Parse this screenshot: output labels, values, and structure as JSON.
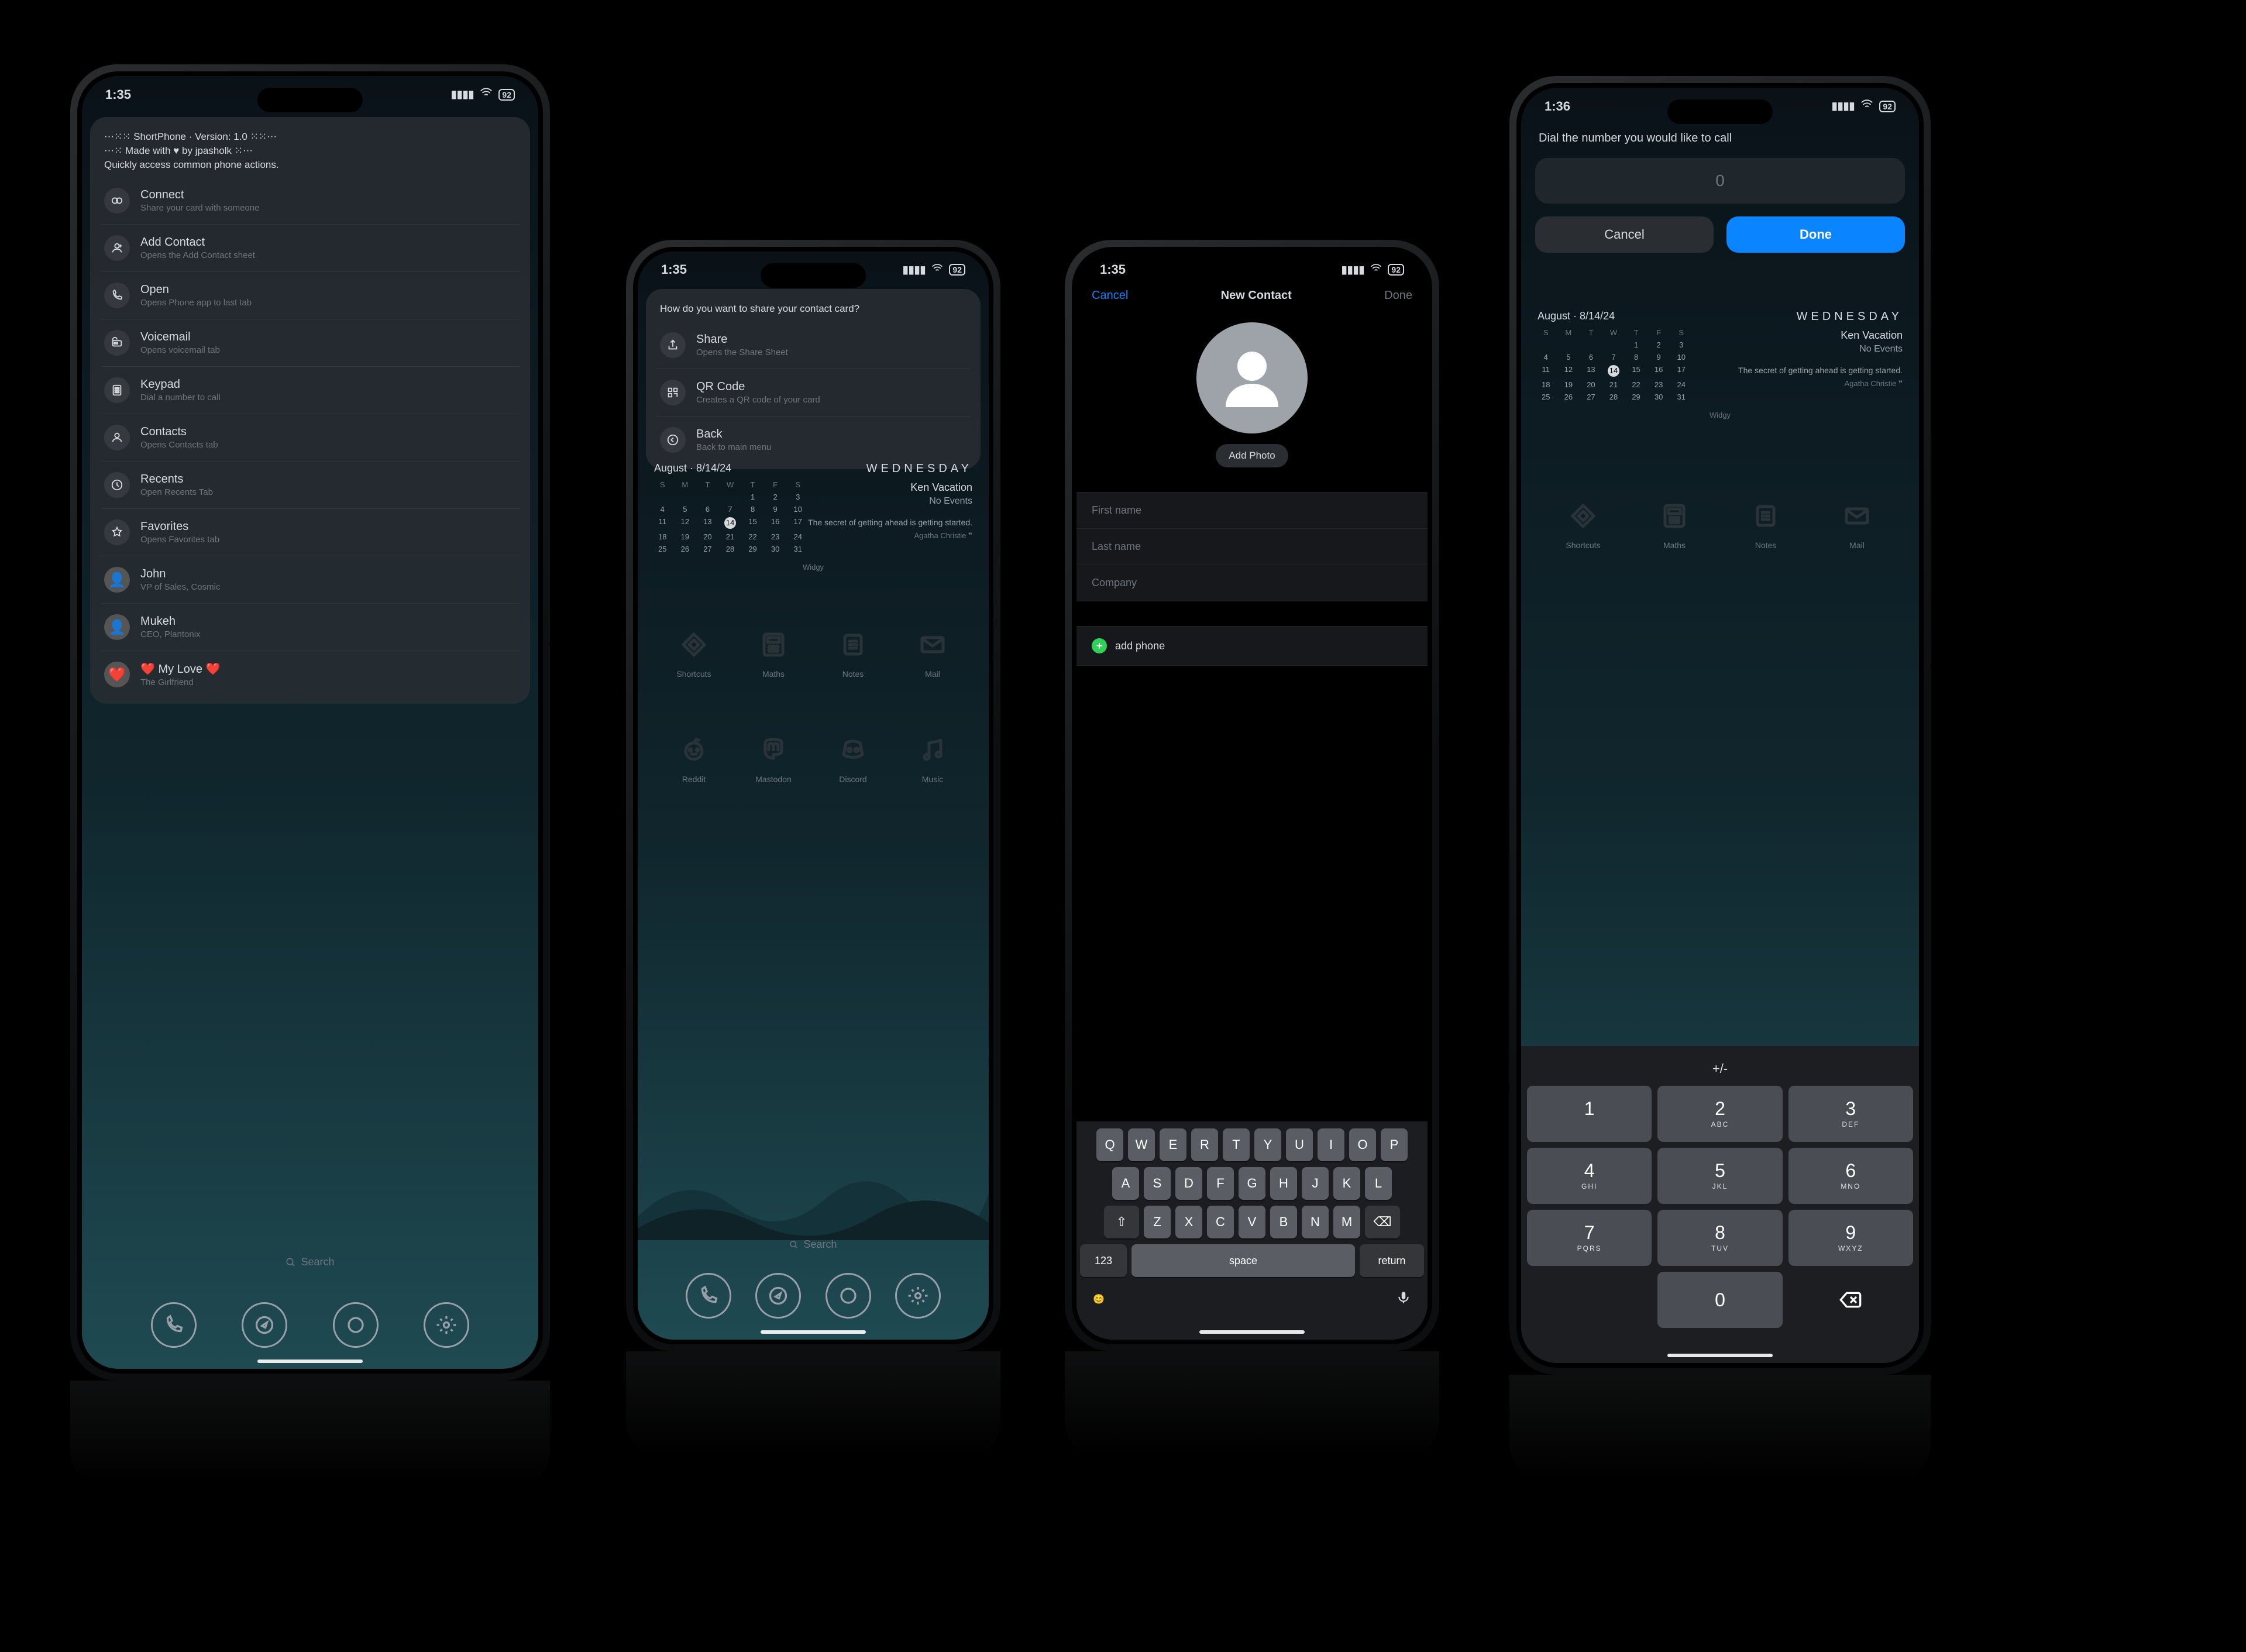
{
  "status": {
    "time1": "1:35",
    "time2": "1:35",
    "time3": "1:35",
    "time4": "1:36",
    "battery": "92"
  },
  "phone1": {
    "header_line1": "⋯⁙⁙ ShortPhone · Version: 1.0 ⁙⁙⋯",
    "header_line2": "⋯⁙ Made with ♥ by jpasholk ⁙⋯",
    "header_line3": "Quickly access common phone actions.",
    "rows": [
      {
        "title": "Connect",
        "sub": "Share your card with someone"
      },
      {
        "title": "Add Contact",
        "sub": "Opens the Add Contact sheet"
      },
      {
        "title": "Open",
        "sub": "Opens Phone app to last tab"
      },
      {
        "title": "Voicemail",
        "sub": "Opens voicemail tab"
      },
      {
        "title": "Keypad",
        "sub": "Dial a number to call"
      },
      {
        "title": "Contacts",
        "sub": "Opens Contacts tab"
      },
      {
        "title": "Recents",
        "sub": "Open Recents Tab"
      },
      {
        "title": "Favorites",
        "sub": "Opens Favorites tab"
      },
      {
        "title": "John",
        "sub": "VP of Sales, Cosmic"
      },
      {
        "title": "Mukeh",
        "sub": "CEO, Plantonix"
      },
      {
        "title": "❤️ My Love ❤️",
        "sub": "The Girlfriend"
      }
    ],
    "search": "Search"
  },
  "phone2": {
    "prompt": "How do you want to share your contact card?",
    "rows": [
      {
        "title": "Share",
        "sub": "Opens the Share Sheet"
      },
      {
        "title": "QR Code",
        "sub": "Creates a QR code of your card"
      },
      {
        "title": "Back",
        "sub": "Back to main menu"
      }
    ],
    "widget": {
      "month": "August",
      "date": "8/14/24",
      "dow": "WEDNESDAY",
      "event_title": "Ken Vacation",
      "event_sub": "No Events",
      "quote": "The secret of getting ahead is getting started.",
      "quote_author": "Agatha Christie",
      "widgy": "Widgy",
      "days_of_week": [
        "S",
        "M",
        "T",
        "W",
        "T",
        "F",
        "S"
      ],
      "weeks": [
        [
          "",
          "",
          "",
          "",
          "1",
          "2",
          "3"
        ],
        [
          "4",
          "5",
          "6",
          "7",
          "8",
          "9",
          "10"
        ],
        [
          "11",
          "12",
          "13",
          "14",
          "15",
          "16",
          "17"
        ],
        [
          "18",
          "19",
          "20",
          "21",
          "22",
          "23",
          "24"
        ],
        [
          "25",
          "26",
          "27",
          "28",
          "29",
          "30",
          "31"
        ]
      ],
      "today": "14"
    },
    "apps_row1": [
      {
        "l": "Shortcuts"
      },
      {
        "l": "Maths"
      },
      {
        "l": "Notes"
      },
      {
        "l": "Mail"
      }
    ],
    "apps_row2": [
      {
        "l": "Reddit"
      },
      {
        "l": "Mastodon"
      },
      {
        "l": "Discord"
      },
      {
        "l": "Music"
      }
    ],
    "search": "Search"
  },
  "phone3": {
    "cancel": "Cancel",
    "title": "New Contact",
    "done": "Done",
    "add_photo": "Add Photo",
    "fields": {
      "first": "First name",
      "last": "Last name",
      "company": "Company"
    },
    "add_phone": "add phone",
    "kbd": {
      "r1": [
        "Q",
        "W",
        "E",
        "R",
        "T",
        "Y",
        "U",
        "I",
        "O",
        "P"
      ],
      "r2": [
        "A",
        "S",
        "D",
        "F",
        "G",
        "H",
        "J",
        "K",
        "L"
      ],
      "r3": [
        "Z",
        "X",
        "C",
        "V",
        "B",
        "N",
        "M"
      ],
      "num": "123",
      "space": "space",
      "return": "return"
    }
  },
  "phone4": {
    "prompt": "Dial the number you would like to call",
    "placeholder": "0",
    "done": "Done",
    "cancel": "Cancel",
    "widget": {
      "month": "August",
      "date": "8/14/24",
      "dow": "WEDNESDAY",
      "event_title": "Ken Vacation",
      "event_sub": "No Events",
      "quote": "The secret of getting ahead is getting started.",
      "quote_author": "Agatha Christie",
      "widgy": "Widgy"
    },
    "apps": [
      {
        "l": "Shortcuts"
      },
      {
        "l": "Maths"
      },
      {
        "l": "Notes"
      },
      {
        "l": "Mail"
      }
    ],
    "numpad": {
      "sym": "+/-",
      "keys": [
        {
          "n": "1",
          "l": ""
        },
        {
          "n": "2",
          "l": "ABC"
        },
        {
          "n": "3",
          "l": "DEF"
        },
        {
          "n": "4",
          "l": "GHI"
        },
        {
          "n": "5",
          "l": "JKL"
        },
        {
          "n": "6",
          "l": "MNO"
        },
        {
          "n": "7",
          "l": "PQRS"
        },
        {
          "n": "8",
          "l": "TUV"
        },
        {
          "n": "9",
          "l": "WXYZ"
        }
      ],
      "zero": "0"
    }
  }
}
